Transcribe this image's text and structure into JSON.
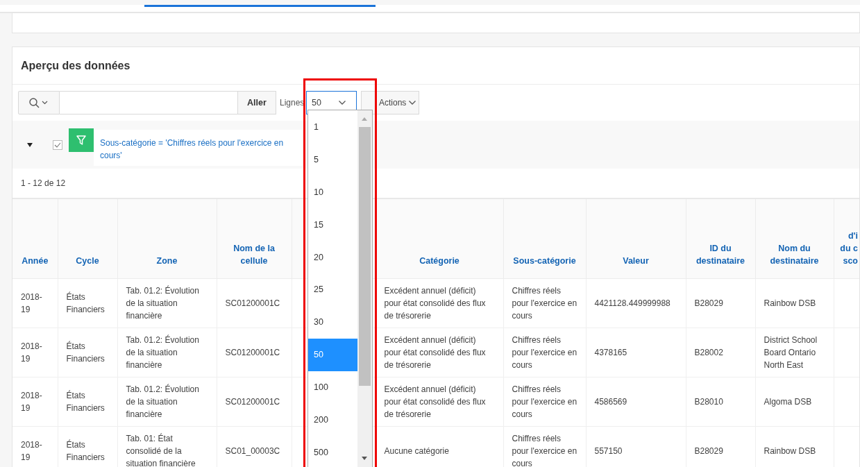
{
  "region": {
    "title": "Aperçu des données"
  },
  "toolbar": {
    "go_button": "Aller",
    "rows_label": "Lignes",
    "rows_select": {
      "value": "50",
      "expanded": true
    },
    "actions_button": "Actions"
  },
  "filter": {
    "enabled": true,
    "checked": true,
    "text": "Sous-catégorie = 'Chiffres réels pour l'exercice en cours'"
  },
  "pagination": "1 - 12 de 12",
  "rows_options": [
    {
      "label": "1",
      "selected": false
    },
    {
      "label": "5",
      "selected": false
    },
    {
      "label": "10",
      "selected": false
    },
    {
      "label": "15",
      "selected": false
    },
    {
      "label": "20",
      "selected": false
    },
    {
      "label": "25",
      "selected": false
    },
    {
      "label": "30",
      "selected": false
    },
    {
      "label": "50",
      "selected": true
    },
    {
      "label": "100",
      "selected": false
    },
    {
      "label": "200",
      "selected": false
    },
    {
      "label": "500",
      "selected": false
    }
  ],
  "table": {
    "columns": [
      "Année",
      "Cycle",
      "Zone",
      "Nom de la cellule",
      "",
      "Catégorie",
      "Sous-catégorie",
      "Valeur",
      "ID du destinataire",
      "Nom du destinataire",
      "d'i\ndu c\nsco"
    ],
    "rows": [
      [
        "2018-19",
        "États Financiers",
        "Tab. 01.2: Évolution de la situation financière",
        "SC01200001C",
        "",
        "Excédent annuel (déficit) pour état consolidé des flux de trésorerie",
        "Chiffres réels pour l'exercice en cours",
        "4421128.449999988",
        "B28029",
        "Rainbow DSB",
        ""
      ],
      [
        "2018-19",
        "États Financiers",
        "Tab. 01.2: Évolution de la situation financière",
        "SC01200001C",
        "",
        "Excédent annuel (déficit) pour état consolidé des flux de trésorerie",
        "Chiffres réels pour l'exercice en cours",
        "4378165",
        "B28002",
        "District School Board Ontario North East",
        ""
      ],
      [
        "2018-19",
        "États Financiers",
        "Tab. 01.2: Évolution de la situation financière",
        "SC01200001C",
        "",
        "Excédent annuel (déficit) pour état consolidé des flux de trésorerie",
        "Chiffres réels pour l'exercice en cours",
        "4586569",
        "B28010",
        "Algoma DSB",
        ""
      ],
      [
        "2018-19",
        "États Financiers",
        "Tab. 01: État consolidé de la situation financière",
        "SC01_00003C",
        "",
        "Aucune catégorie",
        "Chiffres réels pour l'exercice en cours",
        "557150",
        "B28029",
        "Rainbow DSB",
        ""
      ]
    ]
  }
}
